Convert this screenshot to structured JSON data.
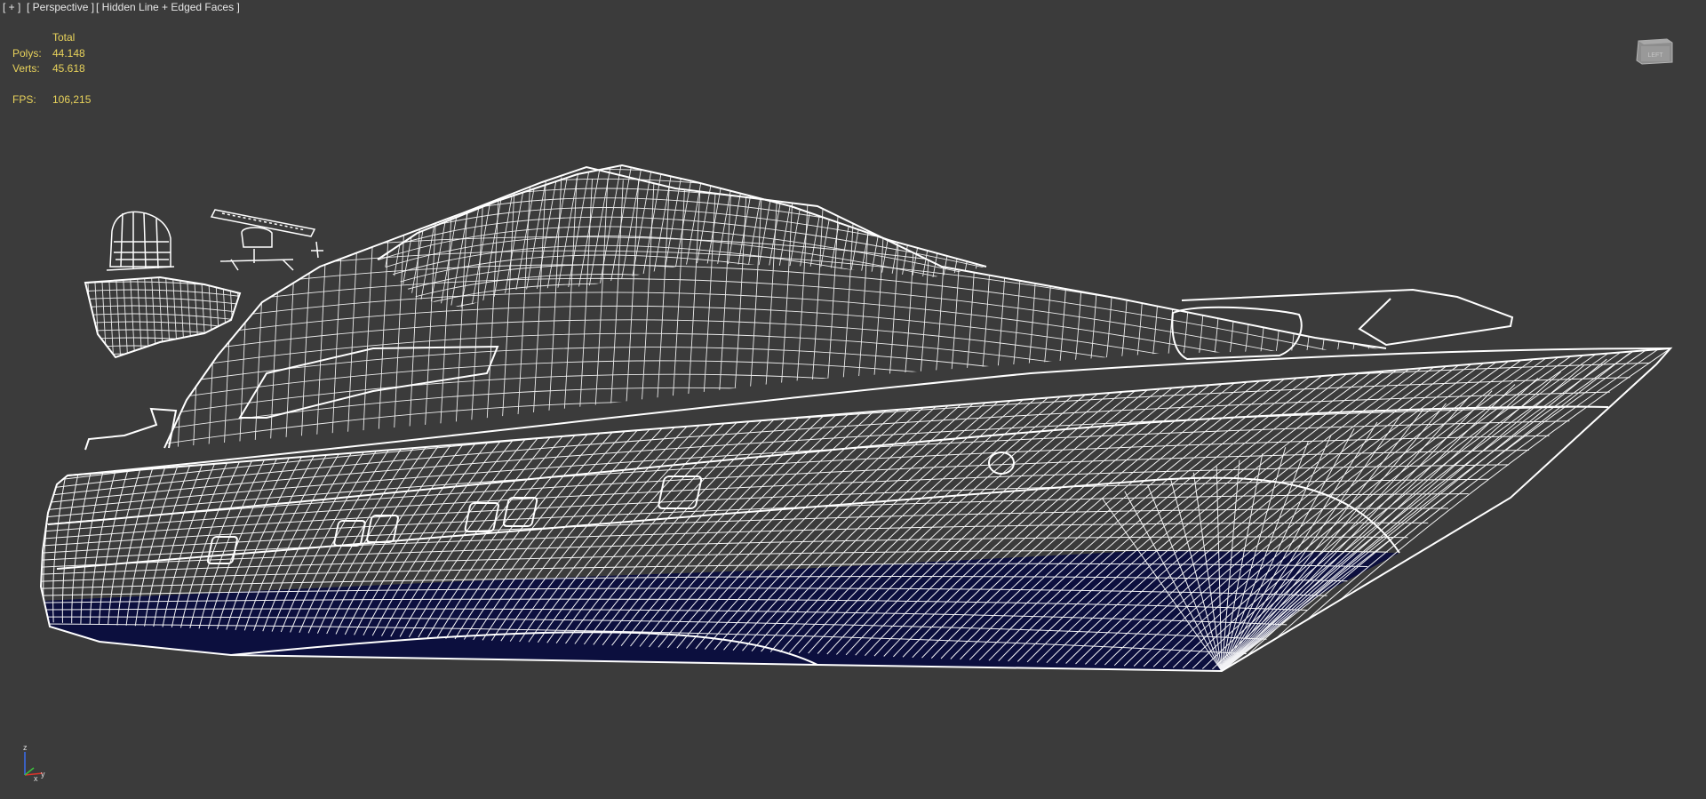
{
  "viewport": {
    "menu_label": "[ + ]",
    "view_label": "[ Perspective ]",
    "shading_label": "[ Hidden Line + Edged Faces ]"
  },
  "stats": {
    "header": "Total",
    "polys_label": "Polys:",
    "polys_value": "44.148",
    "verts_label": "Verts:",
    "verts_value": "45.618",
    "fps_label": "FPS:",
    "fps_value": "106,215"
  },
  "axis_gizmo": {
    "z_label": "z",
    "x_label": "x",
    "y_label": "y"
  },
  "colors": {
    "background": "#3b3b3b",
    "wire": "#ffffff",
    "hull_bottom": "#0c0f3e",
    "stats_text": "#e9d35b",
    "axis_x": "#e0342a",
    "axis_y": "#3cc23c",
    "axis_z": "#3a6cf0"
  },
  "icons": {
    "viewcube": "viewcube-icon",
    "axis": "axis-tripod-icon"
  }
}
